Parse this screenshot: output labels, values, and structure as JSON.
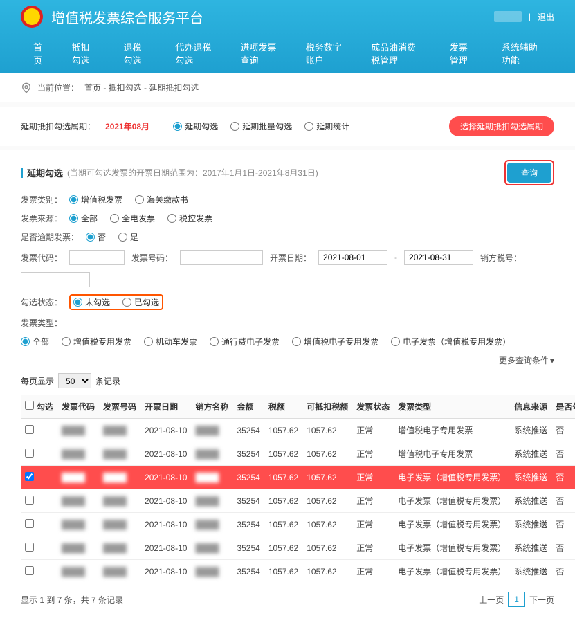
{
  "header": {
    "title": "增值税发票综合服务平台",
    "logout": "退出",
    "nav": [
      "首页",
      "抵扣勾选",
      "退税勾选",
      "代办退税勾选",
      "进项发票查询",
      "税务数字账户",
      "成品油消费税管理",
      "发票管理",
      "系统辅助功能"
    ]
  },
  "breadcrumb": {
    "label": "当前位置：",
    "path": "首页 - 抵扣勾选 - 延期抵扣勾选"
  },
  "period": {
    "label": "延期抵扣勾选属期：",
    "value": "2021年08月",
    "options": [
      "延期勾选",
      "延期批量勾选",
      "延期统计"
    ],
    "select_btn": "选择延期抵扣勾选属期"
  },
  "section": {
    "title": "延期勾选",
    "sub": "(当期可勾选发票的开票日期范围为：2017年1月1日-2021年8月31日)",
    "query_btn": "查询"
  },
  "filters": {
    "category_label": "发票类别：",
    "category_options": [
      "增值税发票",
      "海关缴款书"
    ],
    "source_label": "发票来源：",
    "source_options": [
      "全部",
      "全电发票",
      "税控发票"
    ],
    "overdue_label": "是否逾期发票：",
    "overdue_options": [
      "否",
      "是"
    ],
    "code_label": "发票代码：",
    "number_label": "发票号码：",
    "date_label": "开票日期：",
    "date_from": "2021-08-01",
    "date_to": "2021-08-31",
    "seller_tax_label": "销方税号：",
    "status_label": "勾选状态：",
    "status_options": [
      "未勾选",
      "已勾选"
    ],
    "type_label": "发票类型：",
    "type_options": [
      "全部",
      "增值税专用发票",
      "机动车发票",
      "通行费电子发票",
      "增值税电子专用发票",
      "电子发票（增值税专用发票）"
    ],
    "more": "更多查询条件"
  },
  "page_size": {
    "label": "每页显示",
    "value": "50",
    "suffix": "条记录"
  },
  "table": {
    "headers": [
      "勾选",
      "发票代码",
      "发票号码",
      "开票日期",
      "销方名称",
      "金额",
      "税额",
      "可抵扣税额",
      "发票状态",
      "发票类型",
      "信息来源",
      "是否勾选"
    ],
    "rows": [
      {
        "date": "2021-08-10",
        "amount": "35254",
        "tax": "1057.62",
        "deduct": "1057.62",
        "status": "正常",
        "type": "增值税电子专用发票",
        "src": "系统推送",
        "checked": "否",
        "selected": false
      },
      {
        "date": "2021-08-10",
        "amount": "35254",
        "tax": "1057.62",
        "deduct": "1057.62",
        "status": "正常",
        "type": "增值税电子专用发票",
        "src": "系统推送",
        "checked": "否",
        "selected": false
      },
      {
        "date": "2021-08-10",
        "amount": "35254",
        "tax": "1057.62",
        "deduct": "1057.62",
        "status": "正常",
        "type": "电子发票（增值税专用发票）",
        "src": "系统推送",
        "checked": "否",
        "selected": true
      },
      {
        "date": "2021-08-10",
        "amount": "35254",
        "tax": "1057.62",
        "deduct": "1057.62",
        "status": "正常",
        "type": "电子发票（增值税专用发票）",
        "src": "系统推送",
        "checked": "否",
        "selected": false
      },
      {
        "date": "2021-08-10",
        "amount": "35254",
        "tax": "1057.62",
        "deduct": "1057.62",
        "status": "正常",
        "type": "电子发票（增值税专用发票）",
        "src": "系统推送",
        "checked": "否",
        "selected": false
      },
      {
        "date": "2021-08-10",
        "amount": "35254",
        "tax": "1057.62",
        "deduct": "1057.62",
        "status": "正常",
        "type": "电子发票（增值税专用发票）",
        "src": "系统推送",
        "checked": "否",
        "selected": false
      },
      {
        "date": "2021-08-10",
        "amount": "35254",
        "tax": "1057.62",
        "deduct": "1057.62",
        "status": "正常",
        "type": "电子发票（增值税专用发票）",
        "src": "系统推送",
        "checked": "否",
        "selected": false
      }
    ]
  },
  "pagination": {
    "info": "显示 1 到 7 条，共 7 条记录",
    "prev": "上一页",
    "current": "1",
    "next": "下一页"
  }
}
